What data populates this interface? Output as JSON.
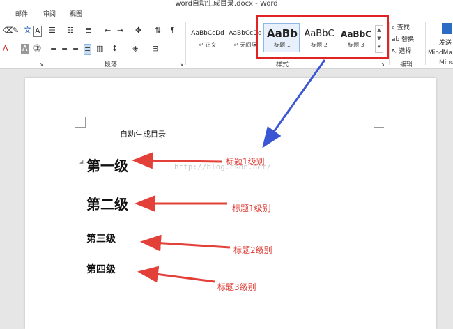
{
  "window": {
    "title": "word自动生成目录.docx - Word"
  },
  "menu": {
    "mail": "邮件",
    "review": "审阅",
    "view": "视图"
  },
  "ribbon": {
    "paragraph_group": "段落",
    "styles_group": "样式",
    "editing_group": "编辑",
    "styles": [
      {
        "preview": "AaBbCcDd",
        "name": "↵ 正文"
      },
      {
        "preview": "AaBbCcDd",
        "name": "↵ 无间隔"
      },
      {
        "preview": "AaBb",
        "name": "标题 1"
      },
      {
        "preview": "AaBbC",
        "name": "标题 2"
      },
      {
        "preview": "AaBbC",
        "name": "标题 3"
      }
    ],
    "find": "查找",
    "replace": "替换",
    "select": "选择",
    "send_label": "发送",
    "mindmap_label": "MindMa",
    "mind_group": "Mind"
  },
  "document": {
    "intro_text": "自动生成目录",
    "headings": [
      "第一级",
      "第二级",
      "第三级",
      "第四级"
    ],
    "watermark": "http://blog.csdn.net/"
  },
  "annotations": [
    "标题1级别",
    "标题1级别",
    "标题2级别",
    "标题3级别"
  ],
  "colors": {
    "highlight": "#e02424",
    "arrow_red": "#e3403a",
    "arrow_blue": "#3a56d4"
  }
}
